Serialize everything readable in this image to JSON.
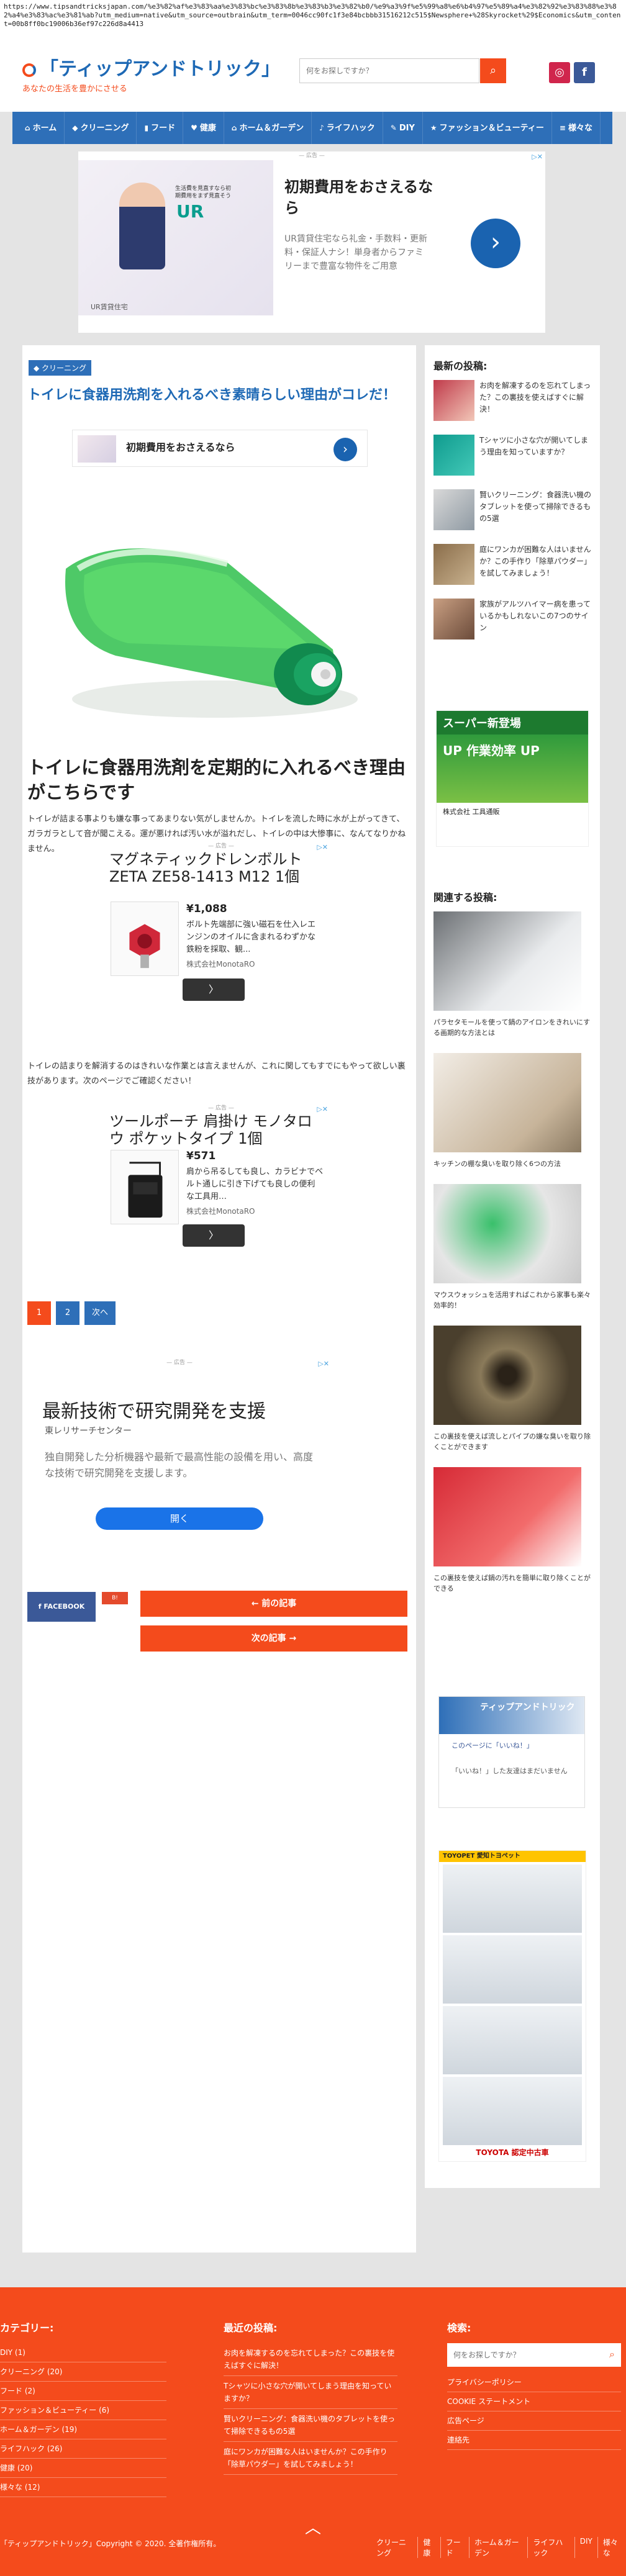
{
  "url": "https://www.tipsandtricksjapan.com/%e3%82%af%e3%83%aa%e3%83%bc%e3%83%8b%e3%83%b3%e3%82%b0/%e9%a3%9f%e5%99%a8%e6%b4%97%e5%89%a4%e3%82%92%e3%83%88%e3%82%a4%e3%83%ac%e3%81%ab?utm_medium=native&utm_source=outbrain&utm_term=0046cc90fc1f3e84bcbbb31516212c515$Newsphere+%28Skyrocket%29$Economics&utm_content=00b8ff0bc19006b36ef97c226d8a4413",
  "header": {
    "logo_title": "「ティップアンドトリック」",
    "logo_subtitle": "あなたの生活を豊かにさせる",
    "search_placeholder": "何をお探しですか？",
    "search_icon": "search-icon",
    "instagram_label": "◎",
    "facebook_label": "f"
  },
  "nav": [
    {
      "icon": "⌂",
      "label": "ホーム"
    },
    {
      "icon": "◆",
      "label": "クリーニング"
    },
    {
      "icon": "▮",
      "label": "フード"
    },
    {
      "icon": "♥",
      "label": "健康"
    },
    {
      "icon": "⌂",
      "label": "ホーム＆ガーデン"
    },
    {
      "icon": "♪",
      "label": "ライフハック"
    },
    {
      "icon": "✎",
      "label": "DIY"
    },
    {
      "icon": "★",
      "label": "ファッション＆ビューティー"
    },
    {
      "icon": "≡",
      "label": "様々な"
    }
  ],
  "top_ad": {
    "tag": "— 広告 —",
    "title": "初期費用をおさえるなら",
    "description": "UR賃貸住宅なら礼金・手数料・更新料・保証人ナシ！単身者からファミリーまで豊富な物件をご用意",
    "brand": "UR賃貸住宅",
    "small_text": "生活費を見直すなら初期費用をまず見直そう",
    "logo_text": "UR"
  },
  "article": {
    "category": "クリーニング",
    "title": "トイレに食器用洗剤を入れるべき素晴らしい理由がコレだ！",
    "inline_ad_text": "初期費用をおさえるなら",
    "heading": "トイレに食器用洗剤を定期的に入れるべき理由がこちらです",
    "paragraph1": "トイレが詰まる事よりも嫌な事ってあまりない気がしませんか。トイレを流した時に水が上がってきて、ガラガラとして音が聞こえる。運が悪ければ汚い水が溢れだし、トイレの中は大惨事に、なんてなりかねません。",
    "paragraph2": "トイレの詰まりを解消するのはきれいな作業とは言えませんが、これに関してもすでにもやって欲しい裏技があります。次のページでご確認ください！"
  },
  "product_ads": [
    {
      "tag": "— 広告 —",
      "name": "マグネティックドレンボルト ZETA ZE58-1413 M12 1個",
      "price": "¥1,088",
      "description": "ボルト先端部に強い磁石を仕入レエンジンのオイルに含まれるわずかな鉄粉を採取、観...",
      "seller": "株式会社MonotaRO",
      "button": "〉"
    },
    {
      "tag": "— 広告 —",
      "name": "ツールポーチ 肩掛け モノタロウ ポケットタイプ 1個",
      "price": "¥571",
      "description": "肩から吊るしても良し、カラビナでベルト通しに引き下げても良しの便利な工具用…",
      "seller": "株式会社MonotaRO",
      "button": "〉"
    }
  ],
  "pagination": [
    "1",
    "2",
    "次へ"
  ],
  "tech_ad": {
    "tag": "— 広告 —",
    "title": "最新技術で研究開発を支援",
    "org": "東レリサーチセンター",
    "description": "独自開発した分析機器や最新で最高性能の設備を用い、高度な技術で研究開発を支援します。",
    "button": "開く"
  },
  "share": {
    "facebook": "f  FACEBOOK",
    "hatena": "B!"
  },
  "post_nav": {
    "prev": "← 前の記事",
    "next": "次の記事 →"
  },
  "sidebar": {
    "recent_title": "最新の投稿:",
    "recent": [
      "お肉を解凍するのを忘れてしまった？この裏技を使えばすぐに解決！",
      "Tシャツに小さな穴が開いてしまう理由を知っていますか？",
      "賢いクリーニング：食器洗い機のタブレットを使って掃除できるもの5選",
      "庭にワンカが困難な人はいませんか？この手作り「除草パウダー」を試してみましょう！",
      "家族がアルツハイマー病を患っているかもしれないこの7つのサイン"
    ],
    "side_ad_top": "スーパー新登場",
    "side_ad_body": "UP 作業効率 UP",
    "side_ad_foot": "株式会社 工具通販",
    "related_title": "関連する投稿:",
    "related": [
      "パラセタモールを使って鍋のアイロンをきれいにする画期的な方法とは",
      "キッチンの棚な臭いを取り除く6つの方法",
      "マウスウォッシュを活用すればこれから家事も楽々効率的！",
      "この裏技を使えば流しとパイプの嫌な臭いを取り除くことができます",
      "この裏技を使えば鍋の汚れを簡単に取り除くことができる"
    ],
    "fb_page": "ティップアンドトリック",
    "fb_like": "このページに「いいね！」",
    "fb_note": "「いいね！」した友達はまだいません",
    "toyota_banner": "TOYOPET 愛知トヨペット",
    "toyota_foot": "TOYOTA 認定中古車"
  },
  "footer": {
    "categories_title": "カテゴリー:",
    "categories": [
      "DIY (1)",
      "クリーニング (20)",
      "フード (2)",
      "ファッション＆ビューティー (6)",
      "ホーム＆ガーデン (19)",
      "ライフハック (26)",
      "健康 (20)",
      "様々な (12)"
    ],
    "recent_title": "最近の投稿:",
    "recent": [
      "お肉を解凍するのを忘れてしまった？この裏技を使えばすぐに解決！",
      "Tシャツに小さな穴が開いてしまう理由を知っていますか？",
      "賢いクリーニング：食器洗い機のタブレットを使って掃除できるもの5選",
      "庭にワンカが困難な人はいませんか？この手作り「除草パウダー」を試してみましょう！"
    ],
    "search_title": "検索:",
    "search_placeholder": "何をお探しですか？",
    "links": [
      "プライバシーポリシー",
      "COOKIE ステートメント",
      "広告ページ",
      "連絡先"
    ],
    "copyright": "「ティップアンドトリック」Copyright © 2020. 全著作権所有。",
    "bottom_nav": [
      "クリーニング",
      "健康",
      "フード",
      "ホーム＆ガーデン",
      "ライフハック",
      "DIY",
      "様々な"
    ],
    "back_top": "︿"
  },
  "colors": {
    "primary_blue": "#2e6fb8",
    "accent_orange": "#f44b1c",
    "facebook_blue": "#3b5998"
  }
}
